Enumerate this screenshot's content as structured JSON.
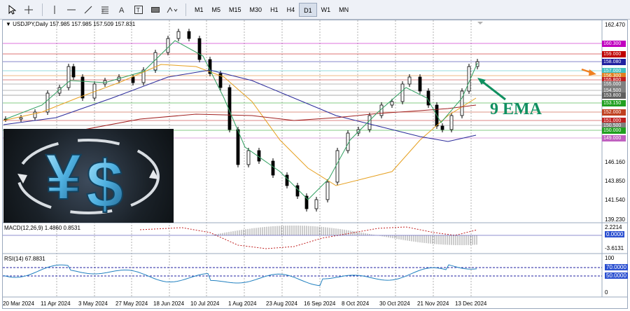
{
  "toolbar": {
    "timeframes": [
      {
        "label": "M1",
        "active": false
      },
      {
        "label": "M5",
        "active": false
      },
      {
        "label": "M15",
        "active": false
      },
      {
        "label": "M30",
        "active": false
      },
      {
        "label": "H1",
        "active": false
      },
      {
        "label": "H4",
        "active": false
      },
      {
        "label": "D1",
        "active": true
      },
      {
        "label": "W1",
        "active": false
      },
      {
        "label": "MN",
        "active": false
      }
    ],
    "icons": [
      "cursor-icon",
      "crosshair-icon",
      "vertical-line-icon",
      "horizontal-line-icon",
      "trendline-icon",
      "fibonacci-icon",
      "text-icon",
      "text-label-icon",
      "rectangle-icon",
      "shapes-icon"
    ]
  },
  "chart": {
    "header": "USDJPY,Daily  157.985 157.985 157.509 157.831",
    "annotation": "9 EMA",
    "price_axis": [
      "162.470",
      "156.300",
      "153.150",
      "151.000",
      "146.160",
      "143.850",
      "141.540",
      "139.230"
    ],
    "price_tags": [
      {
        "label": "160.300",
        "color": "#c000c0"
      },
      {
        "label": "159.000",
        "color": "#c00000"
      },
      {
        "label": "158.080",
        "color": "#2020a0"
      },
      {
        "label": "157.000",
        "color": "#40c0c0"
      },
      {
        "label": "156.300",
        "color": "#e08020"
      },
      {
        "label": "155.800",
        "color": "#c02020"
      },
      {
        "label": "155.000",
        "color": "#808080"
      },
      {
        "label": "154.500",
        "color": "#808080"
      },
      {
        "label": "153.800",
        "color": "#606060"
      },
      {
        "label": "153.150",
        "color": "#20a020"
      },
      {
        "label": "152.000",
        "color": "#c04020"
      },
      {
        "label": "151.000",
        "color": "#c02020"
      },
      {
        "label": "150.500",
        "color": "#808080"
      },
      {
        "label": "150.000",
        "color": "#20a020"
      },
      {
        "label": "149.000",
        "color": "#c060c0"
      }
    ],
    "dates": [
      "20 Mar 2024",
      "11 Apr 2024",
      "3 May 2024",
      "27 May 2024",
      "18 Jun 2024",
      "10 Jul 2024",
      "1 Aug 2024",
      "23 Aug 2024",
      "16 Sep 2024",
      "8 Oct 2024",
      "30 Oct 2024",
      "21 Nov 2024",
      "13 Dec 2024"
    ]
  },
  "macd": {
    "title": "MACD(12,26,9) 1.4860 0.8531",
    "axis": [
      "2.2214",
      "0.0000",
      "-3.6131"
    ]
  },
  "rsi": {
    "title": "RSI(14) 67.8831",
    "axis": [
      "100",
      "70.0000",
      "50.0000",
      "0"
    ]
  }
}
